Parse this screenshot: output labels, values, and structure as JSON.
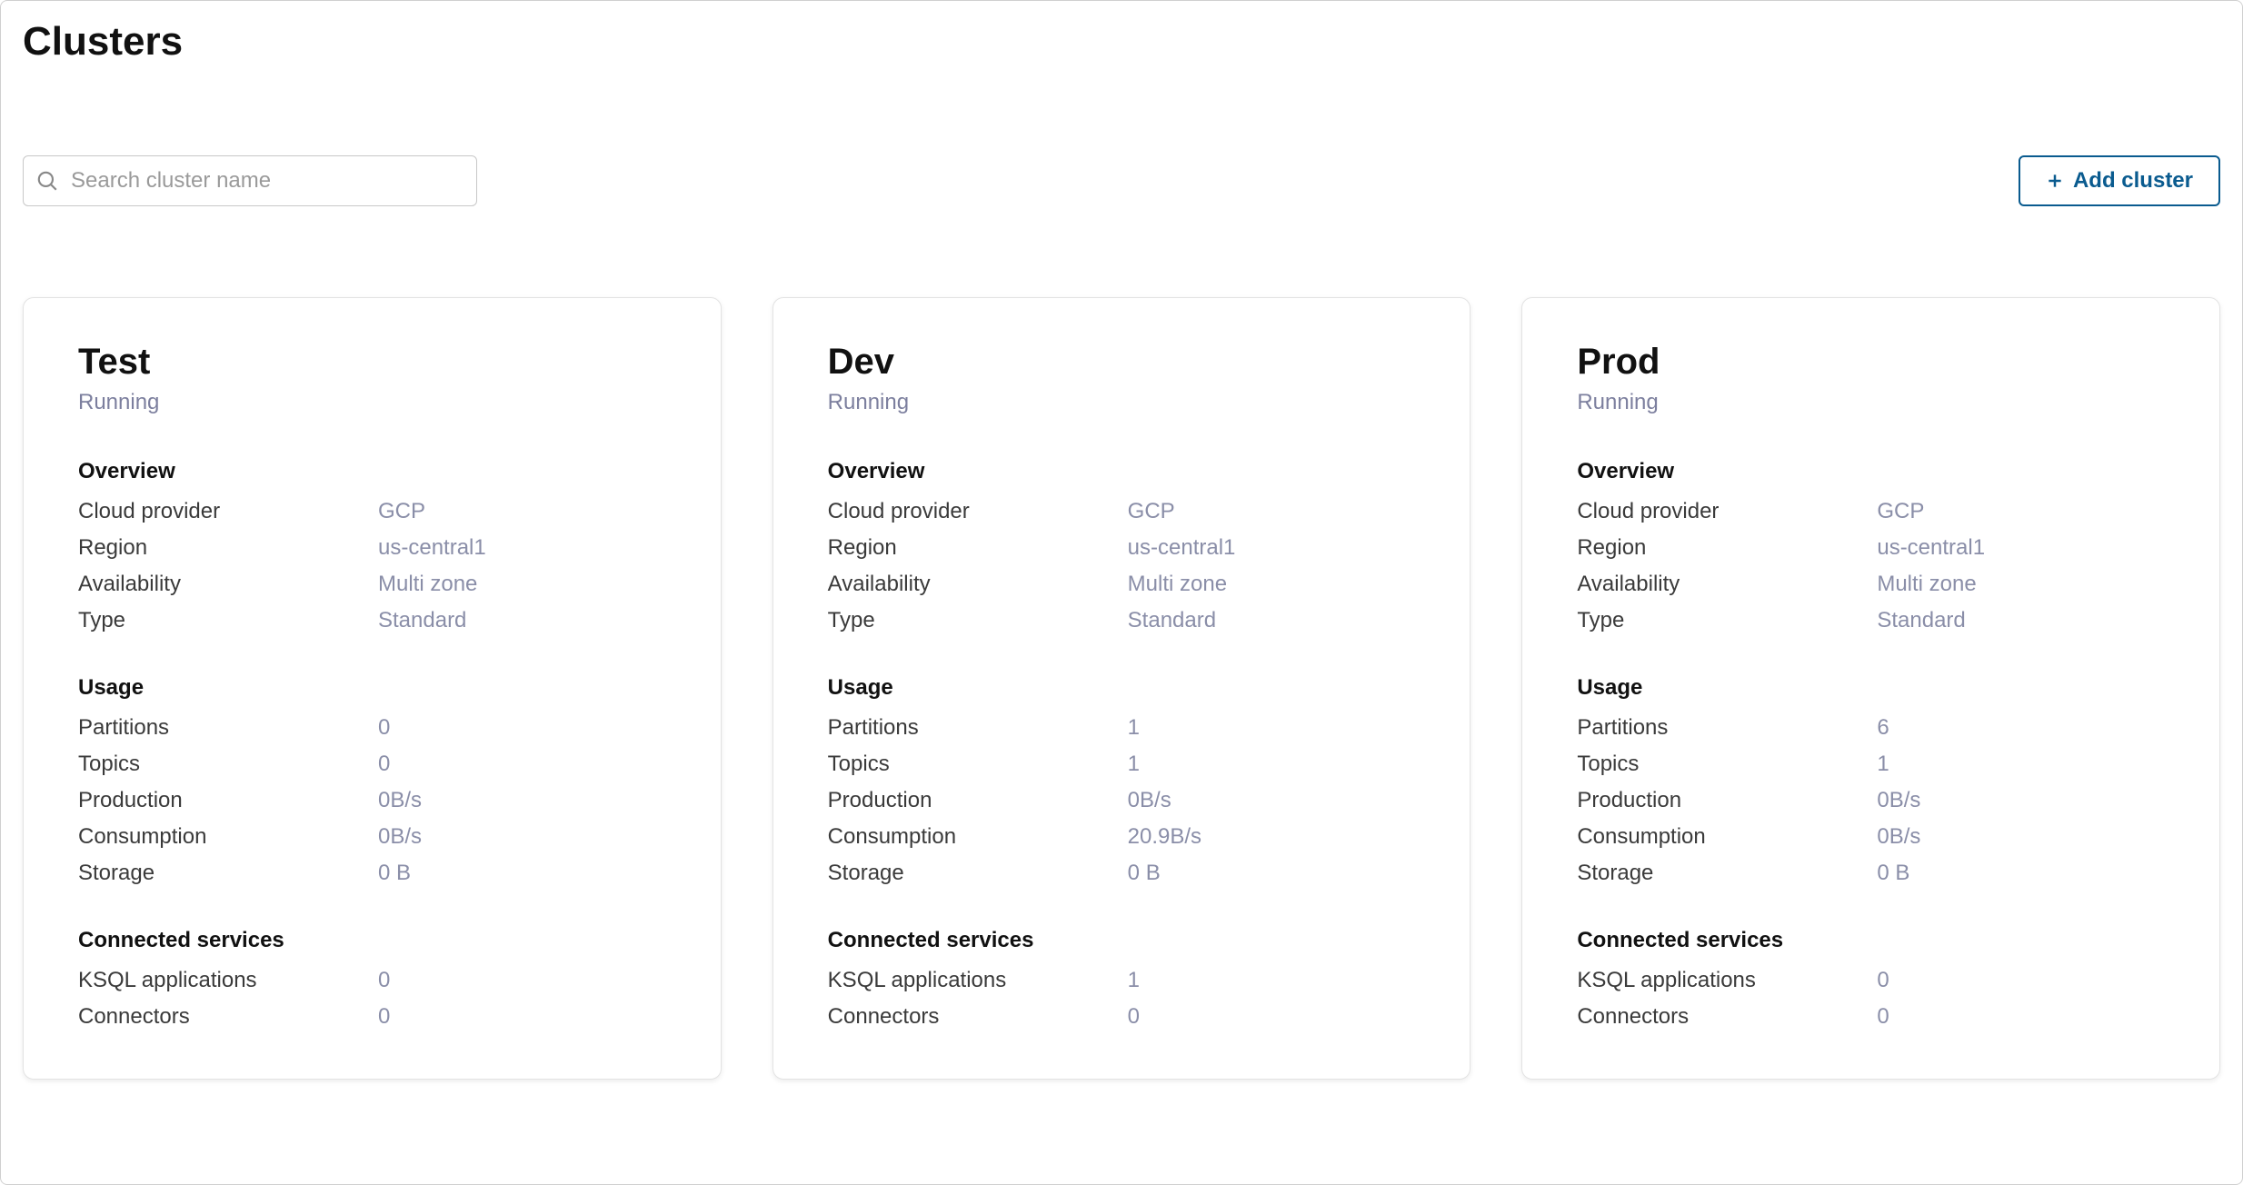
{
  "page": {
    "title": "Clusters"
  },
  "toolbar": {
    "search_placeholder": "Search cluster name",
    "add_cluster_label": "Add cluster"
  },
  "section_labels": {
    "overview": "Overview",
    "usage": "Usage",
    "connected_services": "Connected services"
  },
  "field_labels": {
    "cloud_provider": "Cloud provider",
    "region": "Region",
    "availability": "Availability",
    "type": "Type",
    "partitions": "Partitions",
    "topics": "Topics",
    "production": "Production",
    "consumption": "Consumption",
    "storage": "Storage",
    "ksql_applications": "KSQL applications",
    "connectors": "Connectors"
  },
  "clusters": [
    {
      "name": "Test",
      "status": "Running",
      "overview": {
        "cloud_provider": "GCP",
        "region": "us-central1",
        "availability": "Multi zone",
        "type": "Standard"
      },
      "usage": {
        "partitions": "0",
        "topics": "0",
        "production": "0B/s",
        "consumption": "0B/s",
        "storage": "0 B"
      },
      "connected_services": {
        "ksql_applications": "0",
        "connectors": "0"
      }
    },
    {
      "name": "Dev",
      "status": "Running",
      "overview": {
        "cloud_provider": "GCP",
        "region": "us-central1",
        "availability": "Multi zone",
        "type": "Standard"
      },
      "usage": {
        "partitions": "1",
        "topics": "1",
        "production": "0B/s",
        "consumption": "20.9B/s",
        "storage": "0 B"
      },
      "connected_services": {
        "ksql_applications": "1",
        "connectors": "0"
      }
    },
    {
      "name": "Prod",
      "status": "Running",
      "overview": {
        "cloud_provider": "GCP",
        "region": "us-central1",
        "availability": "Multi zone",
        "type": "Standard"
      },
      "usage": {
        "partitions": "6",
        "topics": "1",
        "production": "0B/s",
        "consumption": "0B/s",
        "storage": "0 B"
      },
      "connected_services": {
        "ksql_applications": "0",
        "connectors": "0"
      }
    }
  ]
}
